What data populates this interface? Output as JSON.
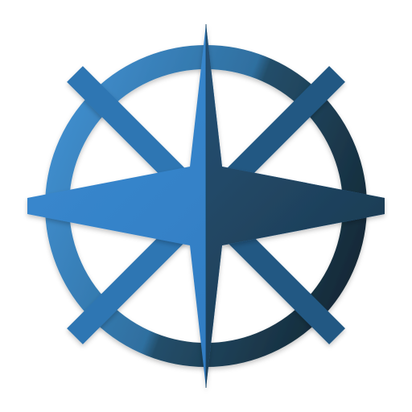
{
  "icon": {
    "name": "compass-rose-icon",
    "colors": {
      "left_light": "#3a8bd0",
      "left_mid": "#2f79c0",
      "right_mid": "#2d5f86",
      "right_dark": "#183345",
      "ring_left": "#3b83bd",
      "ring_right": "#17384d"
    }
  }
}
